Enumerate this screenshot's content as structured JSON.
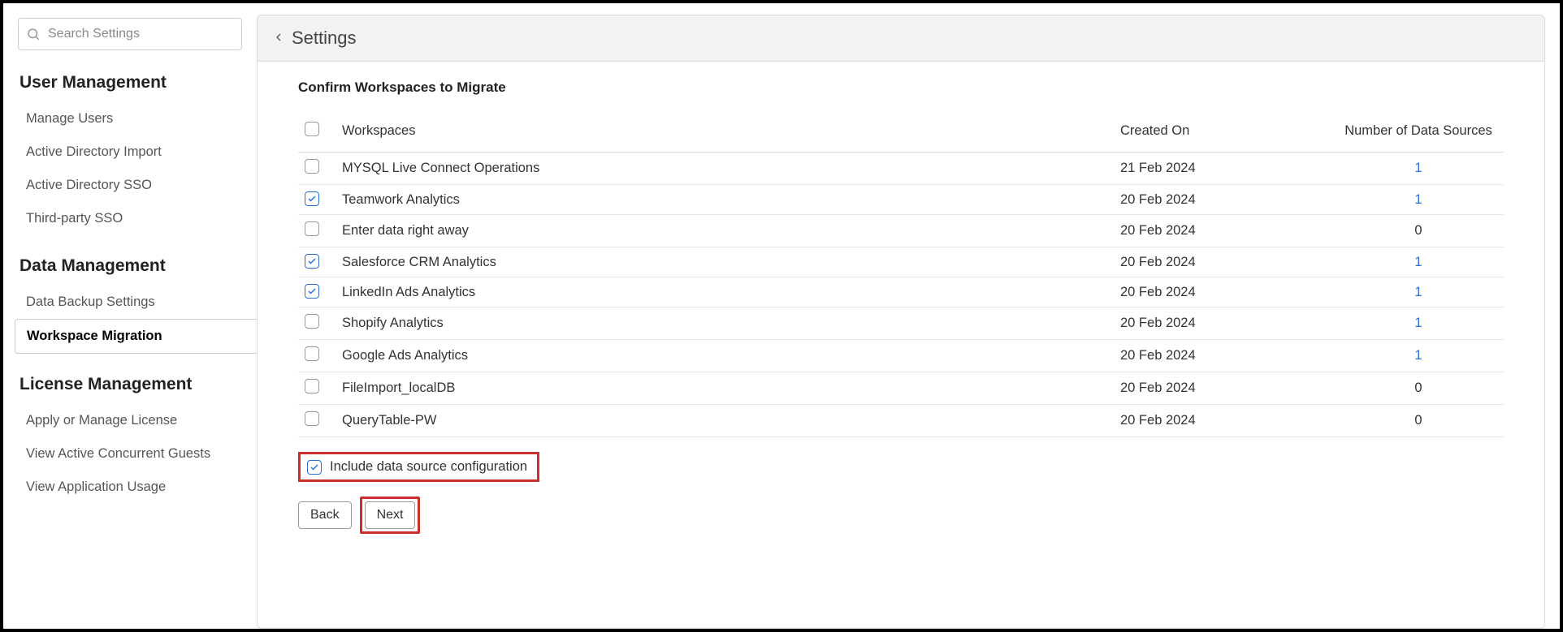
{
  "search": {
    "placeholder": "Search Settings"
  },
  "sidebar": {
    "groups": [
      {
        "title": "User Management",
        "items": [
          {
            "label": "Manage Users",
            "active": false
          },
          {
            "label": "Active Directory Import",
            "active": false
          },
          {
            "label": "Active Directory SSO",
            "active": false
          },
          {
            "label": "Third-party SSO",
            "active": false
          }
        ]
      },
      {
        "title": "Data Management",
        "items": [
          {
            "label": "Data Backup Settings",
            "active": false
          },
          {
            "label": "Workspace Migration",
            "active": true
          }
        ]
      },
      {
        "title": "License Management",
        "items": [
          {
            "label": "Apply or Manage License",
            "active": false
          },
          {
            "label": "View Active Concurrent Guests",
            "active": false
          },
          {
            "label": "View Application Usage",
            "active": false
          }
        ]
      }
    ]
  },
  "header": {
    "title": "Settings"
  },
  "section": {
    "title": "Confirm Workspaces to Migrate"
  },
  "table": {
    "headers": {
      "workspaces": "Workspaces",
      "created": "Created On",
      "sources": "Number of Data Sources"
    },
    "rows": [
      {
        "checked": false,
        "name": "MYSQL Live Connect Operations",
        "created": "21 Feb 2024",
        "sources": "1",
        "link": true
      },
      {
        "checked": true,
        "name": "Teamwork Analytics",
        "created": "20 Feb 2024",
        "sources": "1",
        "link": true
      },
      {
        "checked": false,
        "name": "Enter data right away",
        "created": "20 Feb 2024",
        "sources": "0",
        "link": false
      },
      {
        "checked": true,
        "name": "Salesforce CRM Analytics",
        "created": "20 Feb 2024",
        "sources": "1",
        "link": true
      },
      {
        "checked": true,
        "name": "LinkedIn Ads Analytics",
        "created": "20 Feb 2024",
        "sources": "1",
        "link": true
      },
      {
        "checked": false,
        "name": "Shopify Analytics",
        "created": "20 Feb 2024",
        "sources": "1",
        "link": true
      },
      {
        "checked": false,
        "name": "Google Ads Analytics",
        "created": "20 Feb 2024",
        "sources": "1",
        "link": true
      },
      {
        "checked": false,
        "name": "FileImport_localDB",
        "created": "20 Feb 2024",
        "sources": "0",
        "link": false
      },
      {
        "checked": false,
        "name": "QueryTable-PW",
        "created": "20 Feb 2024",
        "sources": "0",
        "link": false
      }
    ]
  },
  "include": {
    "checked": true,
    "label": "Include data source configuration"
  },
  "buttons": {
    "back": "Back",
    "next": "Next"
  }
}
